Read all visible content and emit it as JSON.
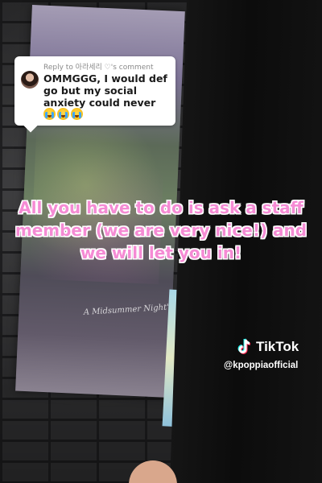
{
  "reply": {
    "header": "Reply to 아라세리 ♡'s comment",
    "comment": "OMMGGG, I would def go but my social anxiety could never",
    "emojis": [
      "crying-emoji",
      "crying-emoji",
      "crying-emoji"
    ]
  },
  "caption": {
    "text": "All you have to do is ask a staff member (we are very nice!) and we will let you in!",
    "color": "#f58bd4"
  },
  "watermark": {
    "brand": "TikTok",
    "handle": "@kpoppiaofficial"
  },
  "poster": {
    "script_text": "A Midsummer Night's Dream"
  }
}
